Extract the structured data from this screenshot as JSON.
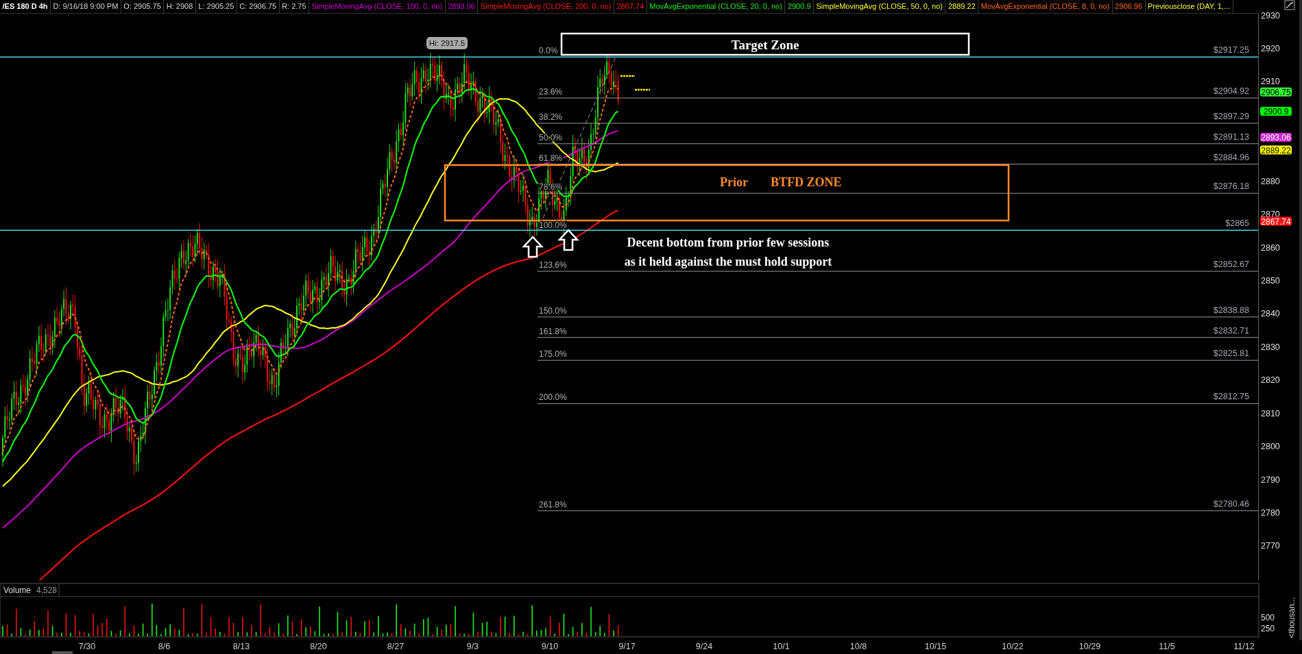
{
  "header": {
    "symbol": "/ES 180 D 4h",
    "fields": [
      "D: 9/16/18 9:00 PM",
      "O: 2905.75",
      "H: 2908",
      "L: 2905.25",
      "C: 2906.75",
      "R: 2.75"
    ],
    "studies": [
      {
        "name": "SimpleMovingAvg (CLOSE, 100, 0, no)",
        "value": "2893.06",
        "color": "#d400d4"
      },
      {
        "name": "SimpleMovingAvg (CLOSE, 200, 0, no)",
        "value": "2867.74",
        "color": "#ff1a1a"
      },
      {
        "name": "MovAvgExponential (CLOSE, 20, 0, no)",
        "value": "2900.9",
        "color": "#22ee22"
      },
      {
        "name": "SimpleMovingAvg (CLOSE, 50, 0, no)",
        "value": "2889.22",
        "color": "#ffff33"
      },
      {
        "name": "MovAvgExponential (CLOSE, 8, 0, no)",
        "value": "2906.96",
        "color": "#ff6a1a"
      },
      {
        "name": "Previousclose (DAY, 1,...",
        "color": "#ffff33"
      }
    ]
  },
  "price_axis": {
    "ticks": [
      "2930",
      "2920",
      "2910",
      "2880",
      "2870",
      "2860",
      "2850",
      "2840",
      "2830",
      "2820",
      "2810",
      "2800",
      "2790",
      "2780",
      "2770"
    ],
    "badges": [
      {
        "value": "2906.75",
        "color": "#33ff33"
      },
      {
        "value": "2900.9",
        "color": "#00ff00"
      },
      {
        "value": "2893.06",
        "color": "#cc22cc"
      },
      {
        "value": "2889.22",
        "color": "#ffff00"
      },
      {
        "value": "2867.74",
        "color": "#ff1111"
      }
    ]
  },
  "high_label": "Hi: 2917.5",
  "fib_levels": [
    {
      "percent": "0.0%",
      "price": "$2917.25"
    },
    {
      "percent": "23.6%",
      "price": "$2904.92"
    },
    {
      "percent": "38.2%",
      "price": "$2897.29"
    },
    {
      "percent": "50.0%",
      "price": "$2891.13"
    },
    {
      "percent": "61.8%",
      "price": "$2884.96"
    },
    {
      "percent": "78.6%",
      "price": "$2876.18"
    },
    {
      "percent": "100.0%",
      "price": "$2865"
    },
    {
      "percent": "123.6%",
      "price": "$2852.67"
    },
    {
      "percent": "150.0%",
      "price": "$2838.88"
    },
    {
      "percent": "161.8%",
      "price": "$2832.71"
    },
    {
      "percent": "175.0%",
      "price": "$2825.81"
    },
    {
      "percent": "200.0%",
      "price": "$2812.75"
    },
    {
      "percent": "261.8%",
      "price": "$2780.46"
    }
  ],
  "annotations": {
    "target_zone": "Target Zone",
    "btfd_zone": [
      "Prior",
      "BTFD ZONE"
    ],
    "note": [
      "Decent bottom from prior few sessions",
      "as it held against the must hold support"
    ]
  },
  "volume": {
    "label": "Volume",
    "value": "4,528",
    "ticks": [
      "500",
      "250"
    ],
    "unit": "<thousan..."
  },
  "date_axis": [
    "7/30",
    "8/6",
    "8/13",
    "8/20",
    "8/27",
    "9/3",
    "9/10",
    "9/17",
    "9/24",
    "10/1",
    "10/8",
    "10/15",
    "10/22",
    "10/29",
    "11/5",
    "11/12"
  ]
}
